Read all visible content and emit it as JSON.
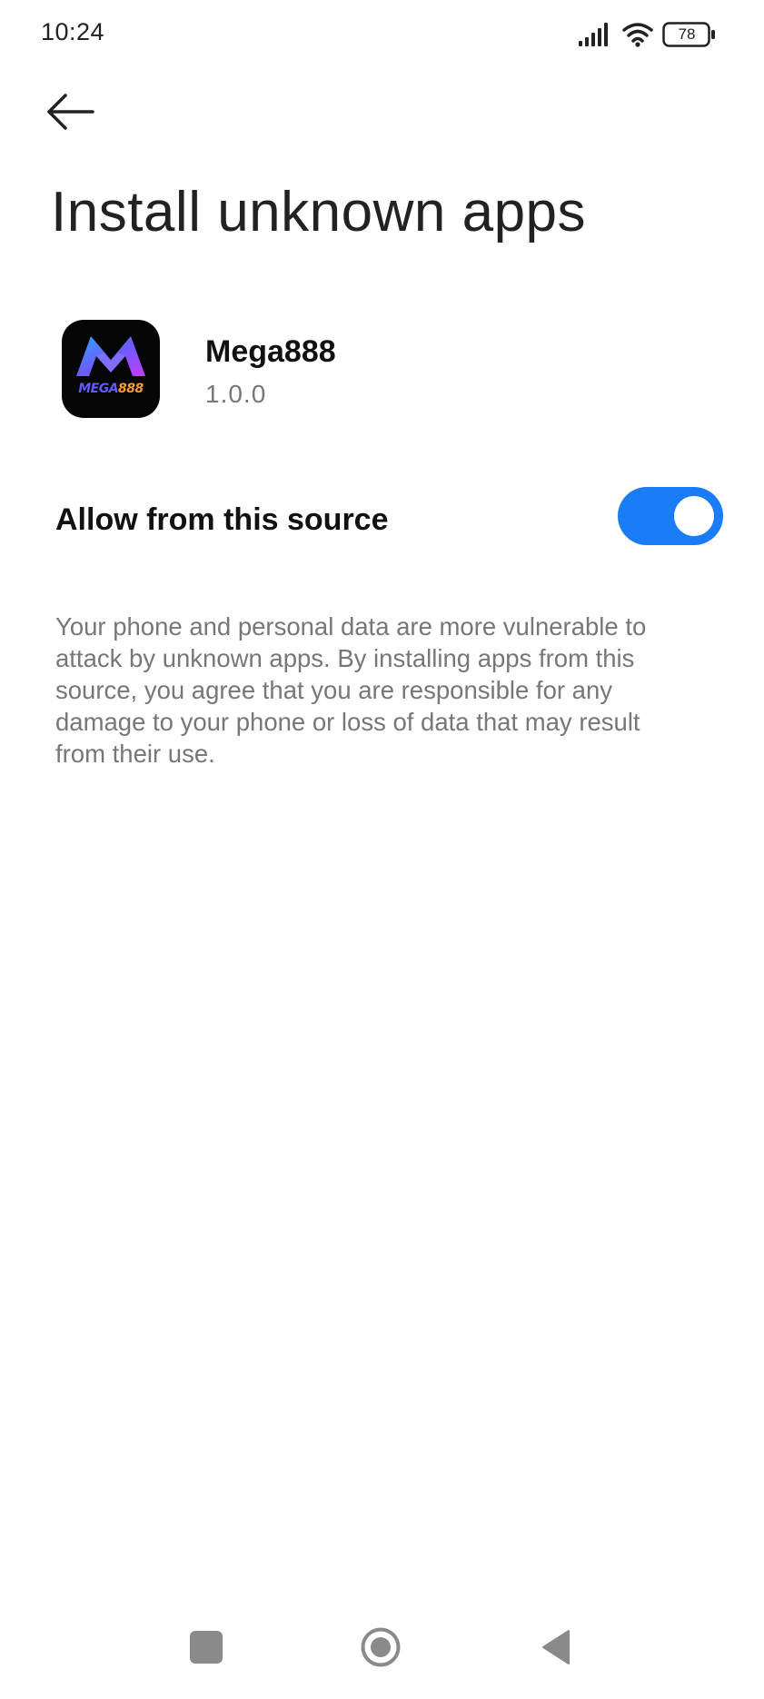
{
  "status_bar": {
    "time": "10:24",
    "battery_level": "78",
    "icons": [
      "signal-icon",
      "wifi-icon",
      "battery-icon"
    ]
  },
  "header": {
    "back_icon": "arrow-left-icon",
    "title": "Install unknown apps"
  },
  "app": {
    "icon": "mega888-app-icon",
    "icon_text_mega": "MEGA",
    "icon_text_num": "888",
    "name": "Mega888",
    "version": "1.0.0"
  },
  "allow_source": {
    "label": "Allow from this source",
    "enabled": true
  },
  "warning": {
    "text": "Your phone and personal data are more vulnerable to attack by unknown apps. By installing apps from this source, you agree that you are responsible for any damage to your phone or loss of data that may result from their use."
  },
  "nav_bar": {
    "items": [
      "recents-icon",
      "home-icon",
      "back-icon"
    ]
  },
  "colors": {
    "accent": "#1a7cf6",
    "title": "#222222",
    "secondary_text": "#777777",
    "nav_icons": "#8a8a8a"
  }
}
